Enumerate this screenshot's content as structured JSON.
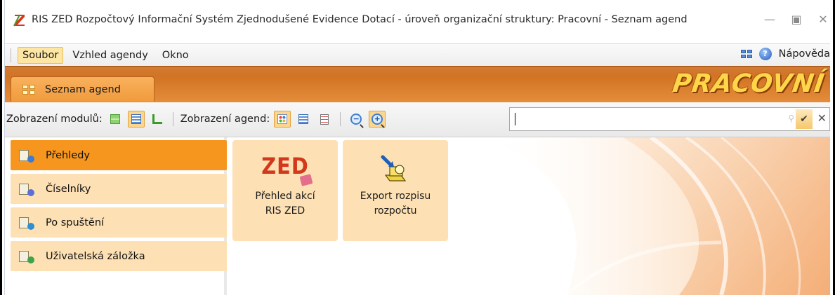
{
  "window": {
    "title": "RIS ZED Rozpočtový Informační Systém Zjednodušené Evidence Dotací - úroveň organizační struktury: Pracovní - Seznam agend"
  },
  "menu": {
    "items": [
      "Soubor",
      "Vzhled agendy",
      "Okno"
    ],
    "help_label": "Nápověda"
  },
  "tabs": {
    "active_label": "Seznam agend",
    "brand": "PRACOVNÍ"
  },
  "toolbar": {
    "modules_label": "Zobrazení modulů:",
    "agendas_label": "Zobrazení agend:",
    "search_value": ""
  },
  "nav": {
    "items": [
      {
        "label": "Přehledy",
        "active": true
      },
      {
        "label": "Číselníky",
        "active": false
      },
      {
        "label": "Po spuštění",
        "active": false
      },
      {
        "label": "Uživatelská záložka",
        "active": false
      }
    ]
  },
  "tiles": [
    {
      "logo_text": "ZED",
      "label_line1": "Přehled akcí",
      "label_line2": "RIS ZED"
    },
    {
      "label_line1": "Export rozpisu",
      "label_line2": "rozpočtu"
    }
  ],
  "colors": {
    "accent_orange": "#f7961f",
    "tile_bg": "#fde0b4",
    "band_orange": "#d47828"
  }
}
